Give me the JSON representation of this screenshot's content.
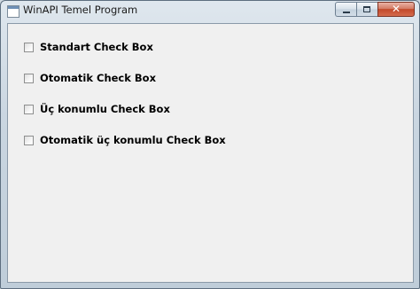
{
  "window": {
    "title": "WinAPI Temel Program",
    "controls": {
      "minimize_icon": "minimize-icon",
      "maximize_icon": "maximize-icon",
      "close_icon": "close-icon",
      "close_glyph": "✕"
    }
  },
  "checkboxes": [
    {
      "label": "Standart Check Box",
      "checked": false
    },
    {
      "label": "Otomatik Check Box",
      "checked": false
    },
    {
      "label": "Üç konumlu Check Box",
      "checked": false
    },
    {
      "label": "Otomatik üç konumlu Check Box",
      "checked": false
    }
  ]
}
